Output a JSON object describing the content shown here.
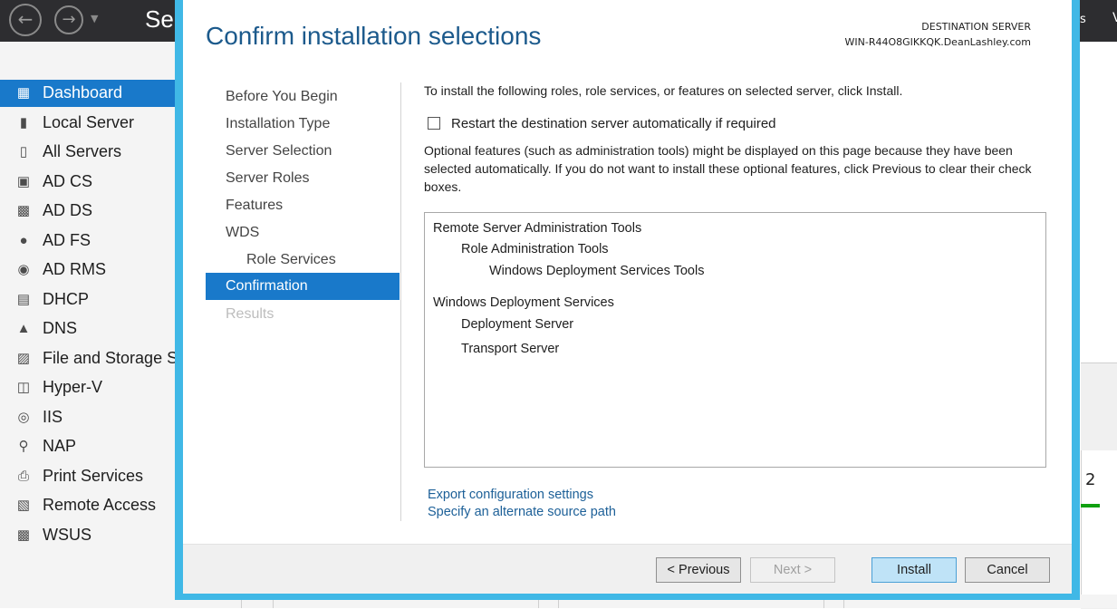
{
  "app": {
    "title": "Ser",
    "top_right_fragment": "s",
    "top_right_fragment2": "V"
  },
  "sidebar": {
    "items": [
      {
        "label": "Dashboard",
        "icon": "dashboard-grid-icon",
        "active": true
      },
      {
        "label": "Local Server",
        "icon": "server-icon"
      },
      {
        "label": "All Servers",
        "icon": "servers-icon"
      },
      {
        "label": "AD CS",
        "icon": "certificate-icon"
      },
      {
        "label": "AD DS",
        "icon": "directory-icon"
      },
      {
        "label": "AD FS",
        "icon": "federation-icon"
      },
      {
        "label": "AD RMS",
        "icon": "rights-management-icon"
      },
      {
        "label": "DHCP",
        "icon": "dhcp-icon"
      },
      {
        "label": "DNS",
        "icon": "dns-icon"
      },
      {
        "label": "File and Storage Se",
        "icon": "file-storage-icon"
      },
      {
        "label": "Hyper-V",
        "icon": "hyperv-icon"
      },
      {
        "label": "IIS",
        "icon": "iis-icon"
      },
      {
        "label": "NAP",
        "icon": "nap-icon"
      },
      {
        "label": "Print Services",
        "icon": "printer-icon"
      },
      {
        "label": "Remote Access",
        "icon": "remote-access-icon"
      },
      {
        "label": "WSUS",
        "icon": "wsus-icon"
      }
    ]
  },
  "background_tile": {
    "count": "2"
  },
  "wizard": {
    "title": "Confirm installation selections",
    "destination_label": "DESTINATION SERVER",
    "destination_server": "WIN-R44O8GIKKQK.DeanLashley.com",
    "steps": [
      {
        "label": "Before You Begin",
        "state": "done"
      },
      {
        "label": "Installation Type",
        "state": "done"
      },
      {
        "label": "Server Selection",
        "state": "done"
      },
      {
        "label": "Server Roles",
        "state": "done"
      },
      {
        "label": "Features",
        "state": "done"
      },
      {
        "label": "WDS",
        "state": "done"
      },
      {
        "label": "Role Services",
        "state": "done",
        "sub": true
      },
      {
        "label": "Confirmation",
        "state": "active"
      },
      {
        "label": "Results",
        "state": "disabled"
      }
    ],
    "intro": "To install the following roles, role services, or features on selected server, click Install.",
    "restart_label": "Restart the destination server automatically if required",
    "restart_checked": false,
    "optional_note": "Optional features (such as administration tools) might be displayed on this page because they have been selected automatically. If you do not want to install these optional features, click Previous to clear their check boxes.",
    "selections": [
      {
        "label": "Remote Server Administration Tools",
        "level": 0
      },
      {
        "label": "Role Administration Tools",
        "level": 1
      },
      {
        "label": "Windows Deployment Services Tools",
        "level": 2
      },
      {
        "label": "Windows Deployment Services",
        "level": 0
      },
      {
        "label": "Deployment Server",
        "level": 1
      },
      {
        "label": "Transport Server",
        "level": 1
      }
    ],
    "links": {
      "export": "Export configuration settings",
      "alternate_source": "Specify an alternate source path"
    },
    "buttons": {
      "previous": "< Previous",
      "next": "Next >",
      "install": "Install",
      "cancel": "Cancel"
    }
  }
}
